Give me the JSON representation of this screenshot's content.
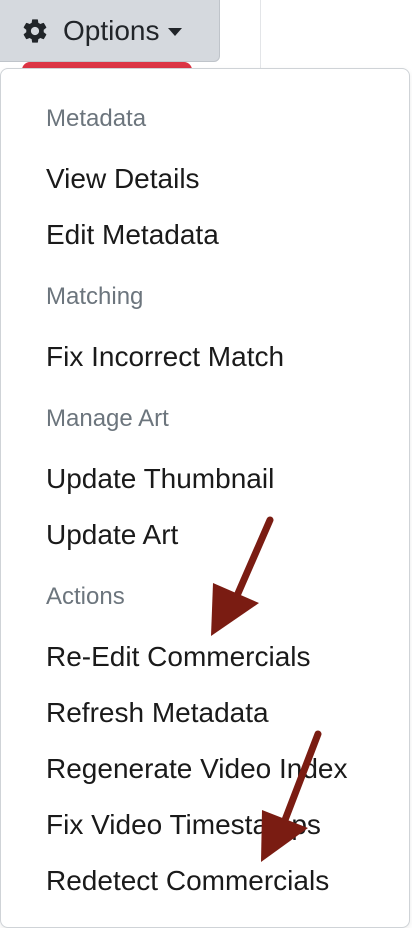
{
  "toolbar": {
    "options_label": "Options"
  },
  "menu": {
    "sections": [
      {
        "header": "Metadata",
        "items": [
          "View Details",
          "Edit Metadata"
        ]
      },
      {
        "header": "Matching",
        "items": [
          "Fix Incorrect Match"
        ]
      },
      {
        "header": "Manage Art",
        "items": [
          "Update Thumbnail",
          "Update Art"
        ]
      },
      {
        "header": "Actions",
        "items": [
          "Re-Edit Commercials",
          "Refresh Metadata",
          "Regenerate Video Index",
          "Fix Video Timestamps",
          "Redetect Commercials"
        ]
      }
    ]
  },
  "colors": {
    "button_bg": "#d5d9de",
    "header_text": "#6c757d",
    "item_text": "#1a1a1a",
    "annotation_arrow": "#7a1c12",
    "tab_accent": "#dc3545"
  }
}
